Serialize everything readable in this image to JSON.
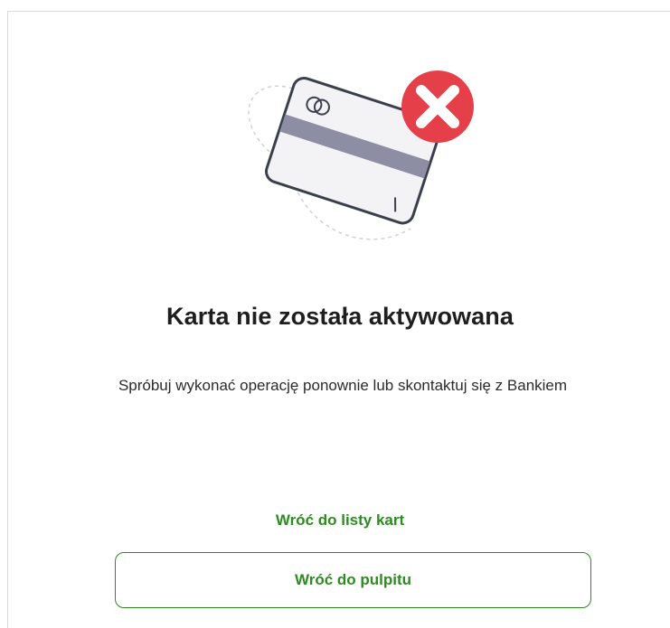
{
  "result": {
    "title": "Karta nie została aktywowana",
    "message": "Spróbuj wykonać operację ponownie lub skontaktuj się z Bankiem",
    "icon": "card-error-illustration",
    "status_icon": "close-icon"
  },
  "actions": {
    "back_to_cards_label": "Wróć do listy kart",
    "back_to_dashboard_label": "Wróć do pulpitu"
  },
  "colors": {
    "accent": "#2c8c1f",
    "error": "#e5404a",
    "title": "#1e1e1e"
  }
}
